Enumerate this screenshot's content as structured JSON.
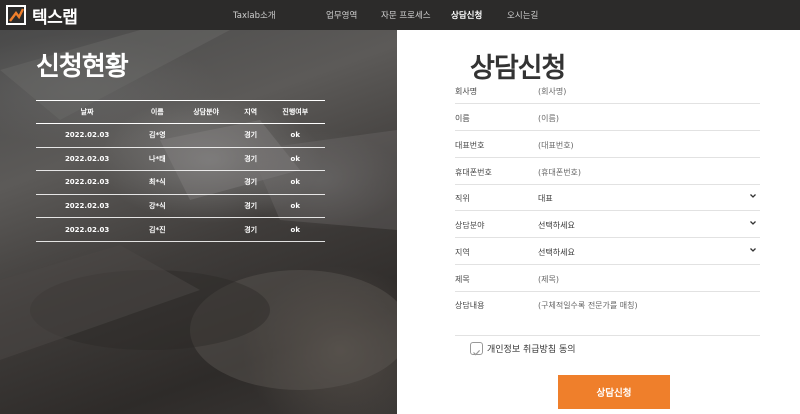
{
  "brand": {
    "name": "텍스랩"
  },
  "nav": {
    "items": [
      {
        "label": "Taxlab소개"
      },
      {
        "label": "업무영역"
      },
      {
        "label": "자문 프로세스"
      },
      {
        "label": "상담신청",
        "active": true
      },
      {
        "label": "오시는길"
      }
    ]
  },
  "status": {
    "title": "신청현황",
    "columns": [
      "날짜",
      "이름",
      "상담분야",
      "지역",
      "진행여부"
    ],
    "rows": [
      [
        "2022.02.03",
        "김*영",
        "",
        "경기",
        "ok"
      ],
      [
        "2022.02.03",
        "나*태",
        "",
        "경기",
        "ok"
      ],
      [
        "2022.02.03",
        "최*식",
        "",
        "경기",
        "ok"
      ],
      [
        "2022.02.03",
        "강*식",
        "",
        "경기",
        "ok"
      ],
      [
        "2022.02.03",
        "김*진",
        "",
        "경기",
        "ok"
      ]
    ]
  },
  "form": {
    "title": "상담신청",
    "fields": [
      {
        "label": "회사명",
        "placeholder": "(회사명)",
        "type": "text"
      },
      {
        "label": "이름",
        "placeholder": "(이름)",
        "type": "text"
      },
      {
        "label": "대표번호",
        "placeholder": "(대표번호)",
        "type": "text"
      },
      {
        "label": "휴대폰번호",
        "placeholder": "(휴대폰번호)",
        "type": "text"
      },
      {
        "label": "직위",
        "value": "대표",
        "type": "select"
      },
      {
        "label": "상담분야",
        "value": "선택하세요",
        "type": "select"
      },
      {
        "label": "지역",
        "value": "선택하세요",
        "type": "select"
      },
      {
        "label": "제목",
        "placeholder": "(제목)",
        "type": "text"
      },
      {
        "label": "상담내용",
        "placeholder": "(구체적일수록 전문가를 매칭)",
        "type": "textarea"
      }
    ],
    "agree_label": "개인정보 취급방침 동의",
    "submit_label": "상담신청"
  },
  "colors": {
    "accent": "#ef7f2b",
    "topbar": "#2c2b2a"
  }
}
